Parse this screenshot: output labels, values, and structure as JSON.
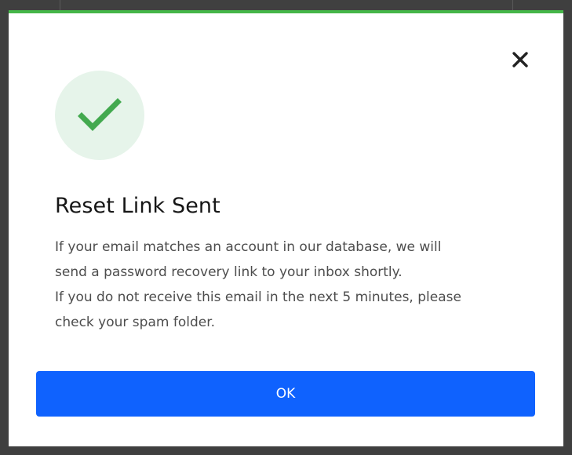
{
  "colors": {
    "accent_bar": "#45b649",
    "check": "#43a94f",
    "check_circle_bg": "#e6f4ea",
    "primary_button": "#0f62fe",
    "close_icon": "#222222"
  },
  "icons": {
    "close": "close-icon",
    "success": "checkmark-icon"
  },
  "modal": {
    "title": "Reset Link Sent",
    "message_lines": [
      "If your email matches an account in our database, we will",
      "send a password recovery link to your inbox shortly.",
      "If you do not receive this email in the next 5 minutes, please",
      "check your spam folder."
    ],
    "ok_label": "OK"
  }
}
